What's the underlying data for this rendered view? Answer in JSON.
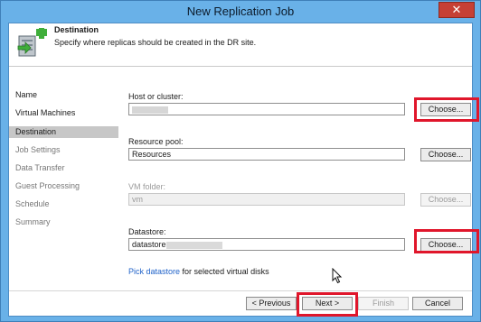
{
  "window": {
    "title": "New Replication Job",
    "close_glyph": "✕"
  },
  "header": {
    "title": "Destination",
    "description": "Specify where replicas should be created in the DR site.",
    "icon": "replication-destination-icon"
  },
  "sidebar": {
    "items": [
      {
        "label": "Name",
        "state": "normal"
      },
      {
        "label": "Virtual Machines",
        "state": "normal"
      },
      {
        "label": "Destination",
        "state": "active"
      },
      {
        "label": "Job Settings",
        "state": "disabled"
      },
      {
        "label": "Data Transfer",
        "state": "disabled"
      },
      {
        "label": "Guest Processing",
        "state": "disabled"
      },
      {
        "label": "Schedule",
        "state": "disabled"
      },
      {
        "label": "Summary",
        "state": "disabled"
      }
    ]
  },
  "fields": {
    "host": {
      "label": "Host or cluster:",
      "value": "",
      "button": "Choose..."
    },
    "resource_pool": {
      "label": "Resource pool:",
      "value": "Resources",
      "button": "Choose..."
    },
    "vm_folder": {
      "label": "VM folder:",
      "value": "vm",
      "button": "Choose..."
    },
    "datastore": {
      "label": "Datastore:",
      "value": "datastore",
      "button": "Choose..."
    }
  },
  "pick": {
    "link": "Pick datastore",
    "text": "for selected virtual disks"
  },
  "footer": {
    "previous": "< Previous",
    "next": "Next >",
    "finish": "Finish",
    "cancel": "Cancel"
  },
  "colors": {
    "titlebar": "#69b1e8",
    "highlight": "#e0162b",
    "link": "#1f62c9",
    "active_nav": "#c7c7c7"
  }
}
